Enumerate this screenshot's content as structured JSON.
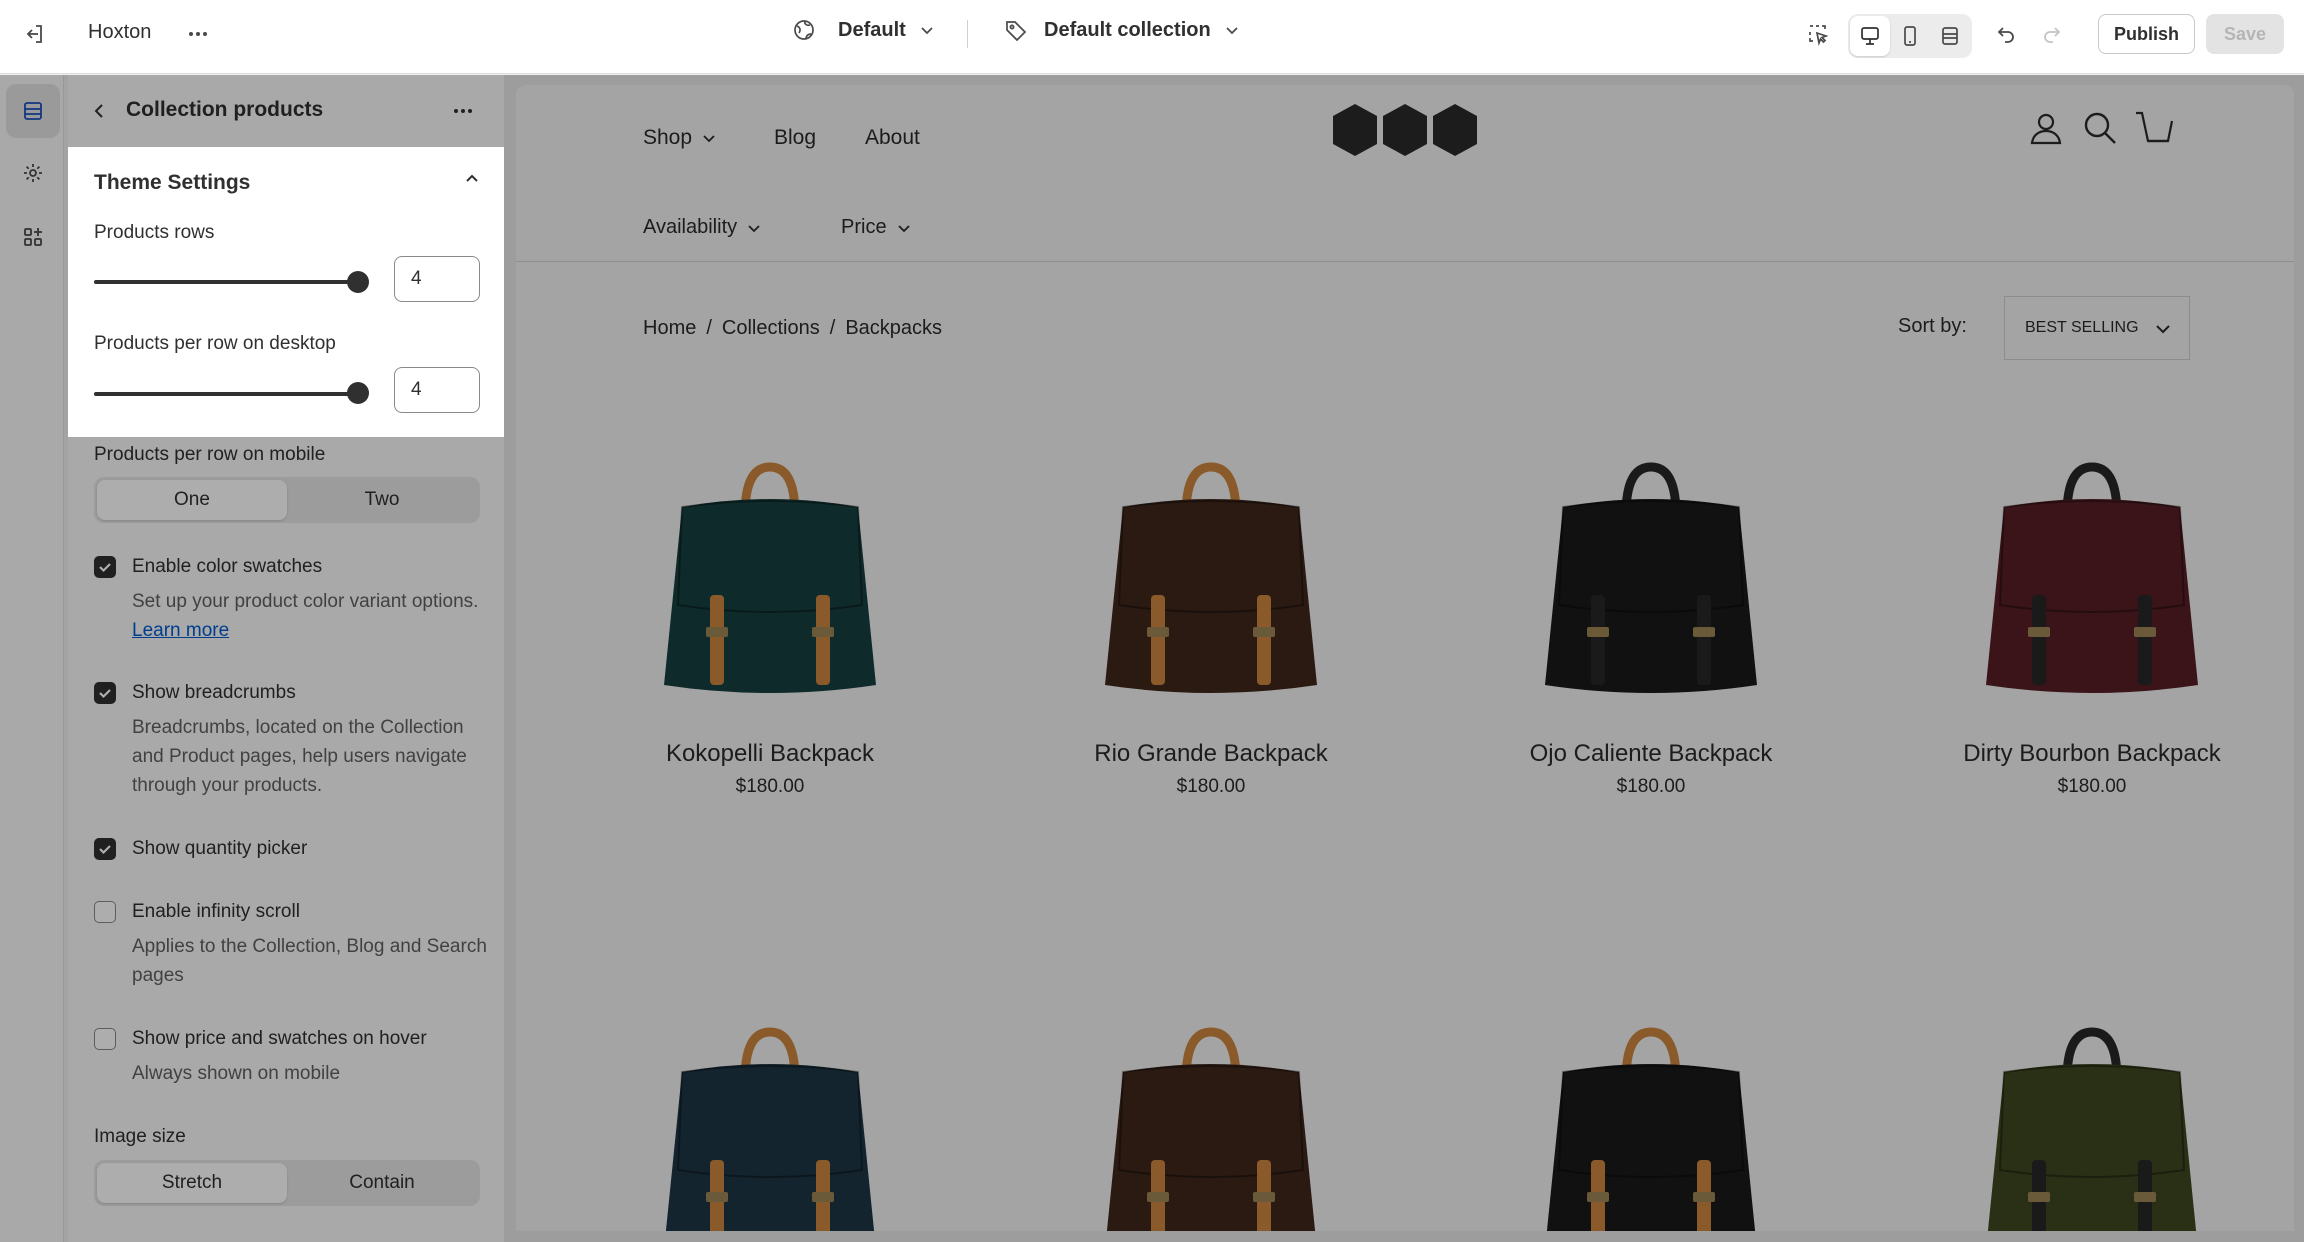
{
  "topbar": {
    "store_name": "Hoxton",
    "theme_select": "Default",
    "template_select": "Default collection",
    "publish_label": "Publish",
    "save_label": "Save"
  },
  "panel": {
    "title": "Collection products",
    "section_title": "Theme Settings",
    "products_rows": {
      "label": "Products rows",
      "value": "4",
      "level": 1.0
    },
    "products_per_row_desktop": {
      "label": "Products per row on desktop",
      "value": "4",
      "level": 1.0
    },
    "products_per_row_mobile": {
      "label": "Products per row on mobile",
      "options": [
        "One",
        "Two"
      ],
      "selected": "One"
    },
    "checkboxes": [
      {
        "label": "Enable color swatches",
        "checked": true,
        "help": "Set up your product color variant options.",
        "link": "Learn more"
      },
      {
        "label": "Show breadcrumbs",
        "checked": true,
        "help": "Breadcrumbs, located on the Collection and Product pages, help users navigate through your products."
      },
      {
        "label": "Show quantity picker",
        "checked": true
      },
      {
        "label": "Enable infinity scroll",
        "checked": false,
        "help": "Applies to the Collection, Blog and Search pages"
      },
      {
        "label": "Show price and swatches on hover",
        "checked": false,
        "help": "Always shown on mobile"
      }
    ],
    "image_size": {
      "label": "Image size",
      "options": [
        "Stretch",
        "Contain"
      ],
      "selected": "Stretch"
    }
  },
  "preview": {
    "nav": [
      "Shop",
      "Blog",
      "About"
    ],
    "filters": [
      "Availability",
      "Price"
    ],
    "breadcrumb": [
      "Home",
      "Collections",
      "Backpacks"
    ],
    "sort_label": "Sort by:",
    "sort_value": "BEST SELLING",
    "products": [
      {
        "name": "Kokopelli Backpack",
        "price": "$180.00",
        "color": "#0f2a2a",
        "strap": "#8a5a2b"
      },
      {
        "name": "Rio Grande Backpack",
        "price": "$180.00",
        "color": "#2a1a12",
        "strap": "#8a5a2b"
      },
      {
        "name": "Ojo Caliente Backpack",
        "price": "$180.00",
        "color": "#111111",
        "strap": "#1a1a1a"
      },
      {
        "name": "Dirty Bourbon Backpack",
        "price": "$180.00",
        "color": "#3a1418",
        "strap": "#1a1a1a"
      }
    ],
    "products_row2": [
      {
        "color": "#13242e",
        "strap": "#8a5a2b"
      },
      {
        "color": "#2a1a12",
        "strap": "#8a5a2b"
      },
      {
        "color": "#111111",
        "strap": "#8a5a2b"
      },
      {
        "color": "#2a3015",
        "strap": "#1a1a1a"
      }
    ]
  }
}
